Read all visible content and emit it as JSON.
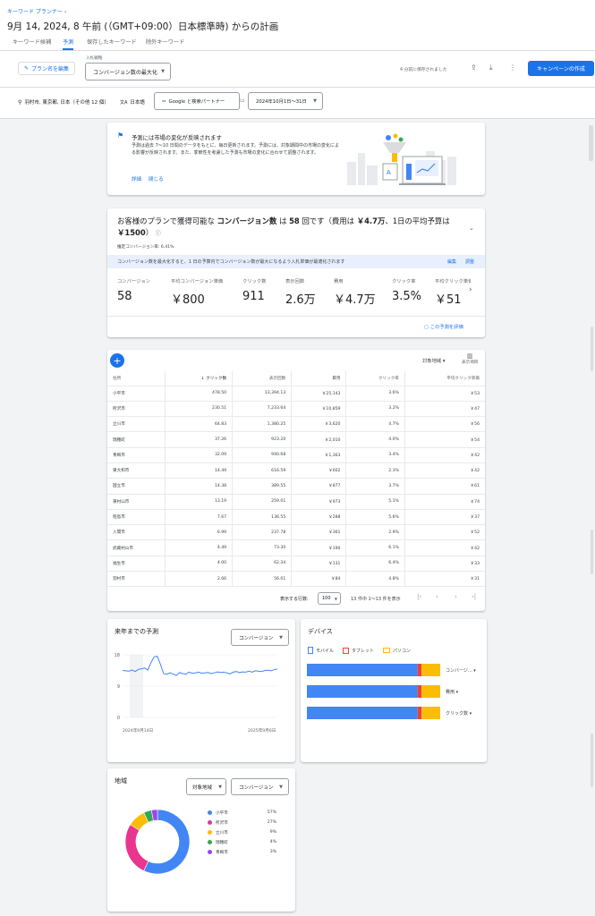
{
  "breadcrumb": "キーワード プランナー",
  "page_title": "9月 14, 2024, 8 午前 (（GMT+09:00）日本標準時) からの計画",
  "tabs": [
    "キーワード候補",
    "予測",
    "保存したキーワード",
    "除外キーワード"
  ],
  "toolbar": {
    "edit_plan": "プラン名を編集",
    "bid_strategy_label": "入札戦略",
    "bid_strategy_value": "コンバージョン数の最大化",
    "saved_text": "4 分前に保存されました",
    "create_campaign": "キャンペーンの作成"
  },
  "filters": {
    "location": "羽村市, 東京都, 日本（その他 12 個）",
    "language": "日本語",
    "network": "Google と検索パートナー",
    "date_range": "2024年10月1日〜31日"
  },
  "notice": {
    "title": "予測には市場の変化が反映されます",
    "body": "予測は過去 7〜10 日間のデータをもとに、毎日更新されます。予測には、対象期間中の市場の変化による影響が反映されます。また、季節性を考慮した予測も市場の変化に合わせて調整されます。",
    "details": "詳細",
    "close": "閉じる"
  },
  "summary": {
    "headline_pre": "お客様のプランで獲得可能な",
    "headline_bold1": "コンバージョン数",
    "headline_mid": "は",
    "headline_bold2": "58",
    "headline_post": "回です（費用は",
    "headline_bold3": "￥4.7万",
    "headline_post2": "、1日の平均予算は",
    "headline_bold4": "￥1500",
    "headline_post3": "）",
    "conv_rate": "推定コンバージョン率: 6.41%",
    "banner": "コンバージョン数を最大化すると、1 日の予算内でコンバージョン数が最大になるよう入札単価が最適化されます",
    "banner_edit": "編集",
    "banner_adjust": "調整",
    "metrics": [
      {
        "label": "コンバージョン",
        "value": "58"
      },
      {
        "label": "平均コンバージョン単価",
        "value": "￥800"
      },
      {
        "label": "クリック数",
        "value": "911"
      },
      {
        "label": "表示回数",
        "value": "2.6万"
      },
      {
        "label": "費用",
        "value": "￥4.7万"
      },
      {
        "label": "クリック率",
        "value": "3.5%"
      },
      {
        "label": "平均クリック単価",
        "value": "￥51"
      }
    ],
    "evaluate_link": "この予測を評価"
  },
  "table": {
    "target_region": "対象地域",
    "columns_label": "表示項目",
    "headers": [
      "住所",
      "クリック数",
      "表示回数",
      "費用",
      "クリック率",
      "平均クリック単価"
    ],
    "rows": [
      [
        "小平市",
        "478.50",
        "13,394.13",
        "￥25,143",
        "3.6%",
        "￥53"
      ],
      [
        "所沢市",
        "230.51",
        "7,233.64",
        "￥10,859",
        "3.2%",
        "￥47"
      ],
      [
        "立川市",
        "64.83",
        "1,380.25",
        "￥3,620",
        "4.7%",
        "￥56"
      ],
      [
        "瑞穂町",
        "37.26",
        "923.20",
        "￥2,010",
        "4.0%",
        "￥54"
      ],
      [
        "青梅市",
        "32.09",
        "940.68",
        "￥1,363",
        "3.4%",
        "￥42"
      ],
      [
        "東大和市",
        "14.49",
        "616.59",
        "￥602",
        "2.3%",
        "￥42"
      ],
      [
        "国立市",
        "14.38",
        "389.55",
        "￥877",
        "3.7%",
        "￥61"
      ],
      [
        "東村山市",
        "13.19",
        "259.01",
        "￥973",
        "5.1%",
        "￥74"
      ],
      [
        "昭島市",
        "7.67",
        "136.55",
        "￥288",
        "5.6%",
        "￥37"
      ],
      [
        "入間市",
        "6.99",
        "237.78",
        "￥361",
        "2.9%",
        "￥52"
      ],
      [
        "武蔵村山市",
        "4.49",
        "73.30",
        "￥190",
        "6.1%",
        "￥42"
      ],
      [
        "福生市",
        "4.00",
        "62.34",
        "￥131",
        "6.4%",
        "￥33"
      ],
      [
        "羽村市",
        "2.66",
        "56.01",
        "￥84",
        "4.8%",
        "￥31"
      ]
    ],
    "rows_per_page_label": "表示する行数:",
    "rows_per_page": "100",
    "range_text": "13 件中 1〜13 件を表示"
  },
  "forecast_card": {
    "title": "来年までの予測",
    "metric": "コンバージョン",
    "y_ticks": [
      "18",
      "9",
      "0"
    ],
    "x_start": "2024年9月14日",
    "x_end": "2025年9月6日"
  },
  "device_card": {
    "title": "デバイス",
    "legend": [
      "モバイル",
      "タブレット",
      "パソコン"
    ],
    "rows": [
      {
        "label": "コンバージ...",
        "mobile": 0.83,
        "tablet": 0.03,
        "desktop": 0.14
      },
      {
        "label": "費用",
        "mobile": 0.83,
        "tablet": 0.03,
        "desktop": 0.14
      },
      {
        "label": "クリック数",
        "mobile": 0.83,
        "tablet": 0.03,
        "desktop": 0.14
      }
    ],
    "colors": {
      "mobile": "#4285f4",
      "tablet": "#ea4335",
      "desktop": "#fbbc04"
    }
  },
  "region_card": {
    "title": "地域",
    "dropdown1": "対象地域",
    "dropdown2": "コンバージョン",
    "items": [
      {
        "name": "小平市",
        "pct": "57%",
        "value": 57,
        "color": "#4285f4"
      },
      {
        "name": "所沢市",
        "pct": "27%",
        "value": 27,
        "color": "#e8368f"
      },
      {
        "name": "立川市",
        "pct": "9%",
        "value": 9,
        "color": "#fbbc04"
      },
      {
        "name": "瑞穂町",
        "pct": "4%",
        "value": 4,
        "color": "#34a853"
      },
      {
        "name": "青梅市",
        "pct": "3%",
        "value": 3,
        "color": "#a142f4"
      }
    ]
  },
  "chart_data": [
    {
      "type": "line",
      "title": "来年までの予測",
      "series": [
        {
          "name": "コンバージョン",
          "values": [
            13.5,
            13.4,
            13.3,
            13.6,
            13.2,
            13.8,
            14.0,
            14.2,
            13.6,
            15.8,
            17.4,
            17.6,
            15.2,
            12.6,
            12.4,
            12.8,
            12.5,
            12.0,
            12.9,
            12.6,
            12.4,
            13.0,
            12.7,
            12.8,
            13.0,
            12.7,
            12.8,
            12.9,
            12.6,
            12.8,
            13.1,
            12.9,
            13.0,
            12.8,
            12.5,
            13.0,
            13.2,
            12.9,
            13.1,
            13.0,
            13.3,
            13.0,
            13.4,
            13.3,
            13.2,
            13.5,
            13.6,
            13.4,
            13.7,
            13.9
          ]
        }
      ],
      "ylim": [
        0,
        18
      ],
      "x_start": "2024年9月14日",
      "x_end": "2025年9月6日"
    },
    {
      "type": "bar",
      "title": "デバイス",
      "categories": [
        "コンバージ...",
        "費用",
        "クリック数"
      ],
      "series": [
        {
          "name": "モバイル",
          "values": [
            0.83,
            0.83,
            0.83
          ]
        },
        {
          "name": "タブレット",
          "values": [
            0.03,
            0.03,
            0.03
          ]
        },
        {
          "name": "パソコン",
          "values": [
            0.14,
            0.14,
            0.14
          ]
        }
      ]
    },
    {
      "type": "pie",
      "title": "地域",
      "categories": [
        "小平市",
        "所沢市",
        "立川市",
        "瑞穂町",
        "青梅市"
      ],
      "values": [
        57,
        27,
        9,
        4,
        3
      ]
    }
  ]
}
